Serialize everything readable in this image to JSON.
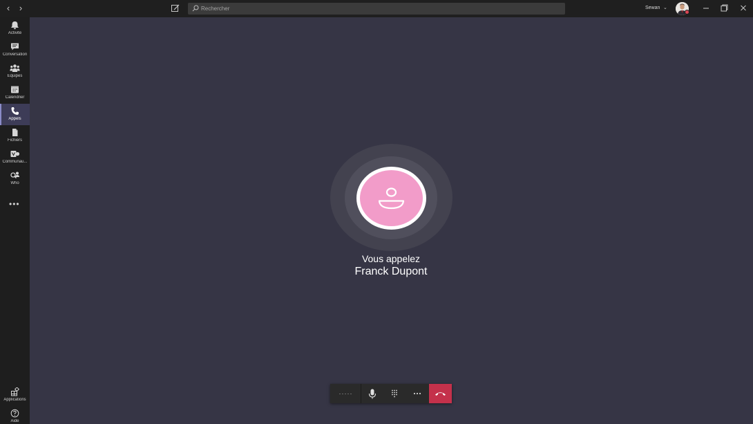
{
  "titlebar": {
    "search_placeholder": "Rechercher",
    "user_name": "Sewan"
  },
  "sidebar": {
    "items": [
      {
        "label": "Activité",
        "icon": "bell-icon"
      },
      {
        "label": "Conversation",
        "icon": "chat-icon"
      },
      {
        "label": "Équipes",
        "icon": "teams-icon"
      },
      {
        "label": "Calendrier",
        "icon": "calendar-icon"
      },
      {
        "label": "Appels",
        "icon": "phone-icon",
        "active": true
      },
      {
        "label": "Fichiers",
        "icon": "file-icon"
      },
      {
        "label": "Communau...",
        "icon": "community-icon"
      },
      {
        "label": "Who",
        "icon": "who-icon"
      }
    ],
    "bottom_items": [
      {
        "label": "Applications",
        "icon": "apps-icon"
      },
      {
        "label": "Aide",
        "icon": "help-icon"
      }
    ]
  },
  "call": {
    "status": "Vous appelez",
    "contact_name": "Franck Dupont"
  },
  "colors": {
    "background": "#363545",
    "avatar_pink": "#f29cc9",
    "hangup_red": "#c4314b",
    "active_accent": "#8b8cc7"
  }
}
